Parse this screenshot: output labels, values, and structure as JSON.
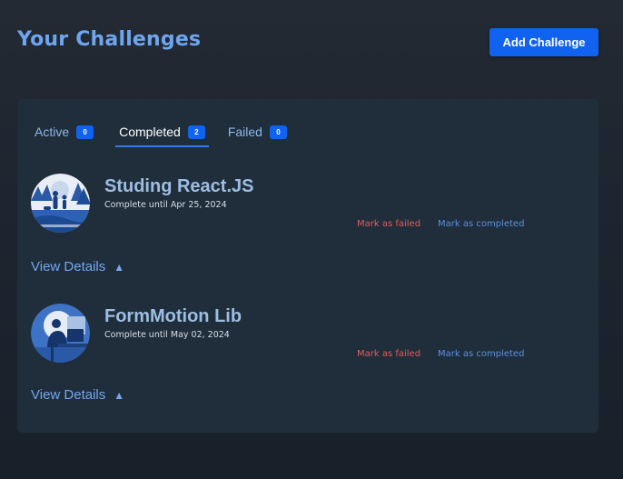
{
  "header": {
    "title": "Your Challenges",
    "add_button_label": "Add Challenge"
  },
  "tabs": [
    {
      "label": "Active",
      "count": "0"
    },
    {
      "label": "Completed",
      "count": "2"
    },
    {
      "label": "Failed",
      "count": "0"
    }
  ],
  "challenges": [
    {
      "title": "Studing React.JS",
      "subtitle": "Complete until Apr 25, 2024",
      "mark_failed": "Mark as failed",
      "mark_completed": "Mark as completed",
      "view_details": "View Details",
      "image_icon": "family-forest-illustration"
    },
    {
      "title": "FormMotion Lib",
      "subtitle": "Complete until May 02, 2024",
      "mark_failed": "Mark as failed",
      "mark_completed": "Mark as completed",
      "view_details": "View Details",
      "image_icon": "person-at-computer-illustration"
    }
  ],
  "colors": {
    "accent": "#0f63f0",
    "title": "#6ea5ee",
    "failed": "#e65b5b",
    "completed": "#5d8fe0"
  }
}
